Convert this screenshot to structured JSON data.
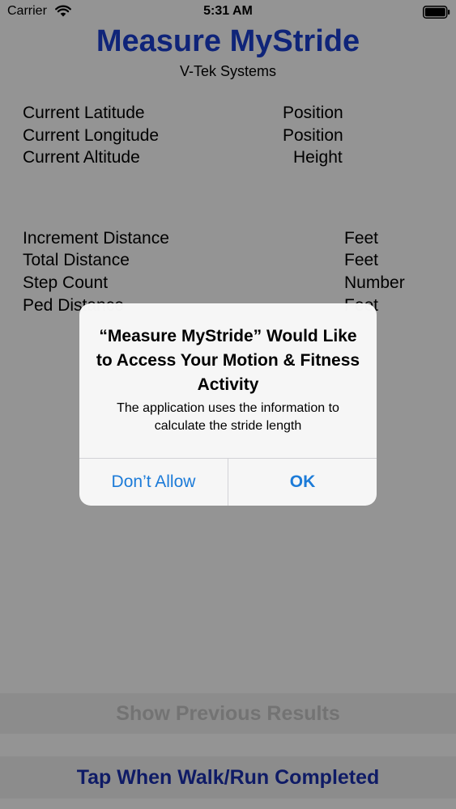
{
  "status_bar": {
    "carrier": "Carrier",
    "time": "5:31 AM",
    "icons": [
      "wifi-icon",
      "battery-icon"
    ]
  },
  "header": {
    "title": "Measure MyStride",
    "subtitle": "V-Tek Systems"
  },
  "location": [
    {
      "label": "Current Latitude",
      "value": "Position"
    },
    {
      "label": "Current Longitude",
      "value": "Position"
    },
    {
      "label": "Current Altitude",
      "value": "Height"
    }
  ],
  "distance": [
    {
      "label": "Increment Distance",
      "value": "Feet"
    },
    {
      "label": "Total Distance",
      "value": "Feet"
    },
    {
      "label": "Step Count",
      "value": "Number"
    },
    {
      "label": "Ped Distance",
      "value": "Feet"
    }
  ],
  "buttons": {
    "show_previous": "Show Previous Results",
    "walk_completed": "Tap When Walk/Run Completed"
  },
  "alert": {
    "title": "“Measure MyStride” Would Like to Access Your Motion & Fitness Activity",
    "message": "The application uses the information to calculate the stride length",
    "deny_label": "Don’t Allow",
    "ok_label": "OK"
  },
  "colors": {
    "title_blue": "#1a3fd0",
    "button_blue": "#1a2fb0",
    "alert_link_blue": "#1c7bd8",
    "disabled_text": "#c6c6c6"
  }
}
